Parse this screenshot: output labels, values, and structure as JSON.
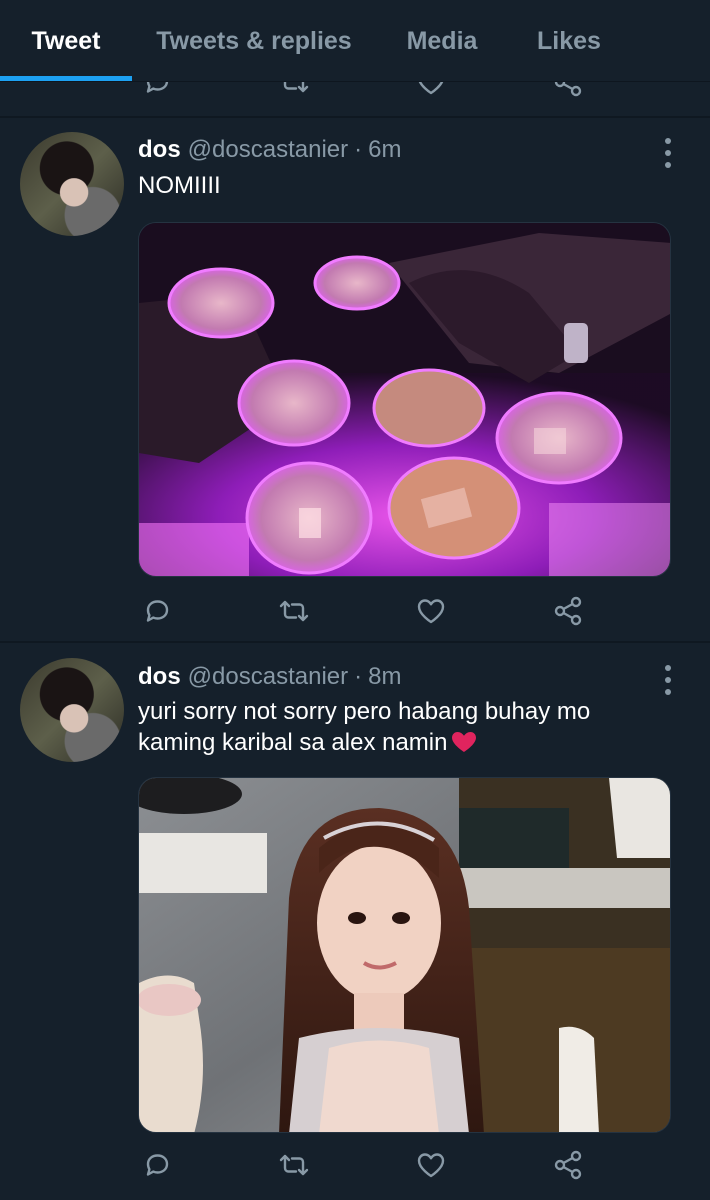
{
  "tabs": [
    {
      "label": "Tweet",
      "active": true
    },
    {
      "label": "Tweets & replies",
      "active": false
    },
    {
      "label": "Media",
      "active": false
    },
    {
      "label": "Likes",
      "active": false
    }
  ],
  "colors": {
    "background": "#15202b",
    "accent": "#1da1f2",
    "secondary_text": "#8899a6",
    "emoji_heart": "#e0245e"
  },
  "action_icons": [
    "reply-icon",
    "retweet-icon",
    "like-icon",
    "share-icon"
  ],
  "tweets": [
    {
      "name": "dos",
      "handle": "@doscastanier",
      "separator": "·",
      "time": "6m",
      "text": "NOMIIII",
      "media_description_icon": "photo-drinks"
    },
    {
      "name": "dos",
      "handle": "@doscastanier",
      "separator": "·",
      "time": "8m",
      "text": "yuri sorry not sorry pero habang buhay mo kaming karibal sa alex namin",
      "emoji": "red-heart",
      "media_description_icon": "photo-portrait"
    }
  ]
}
